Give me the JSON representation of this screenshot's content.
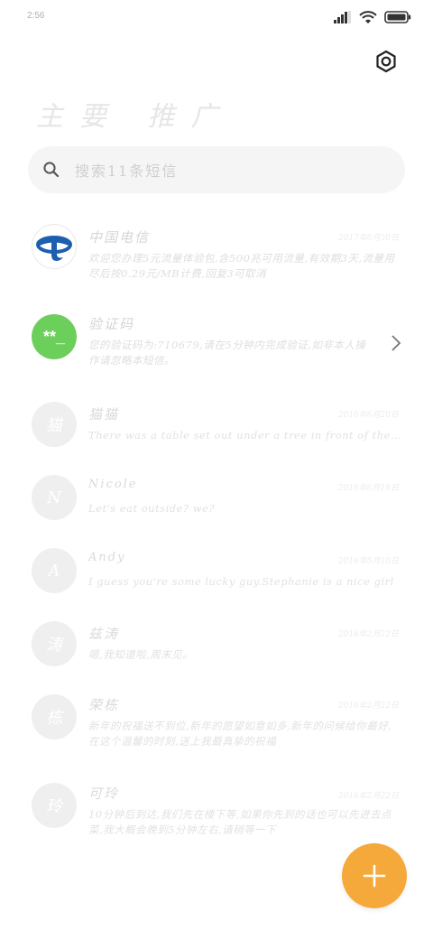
{
  "status_bar": {
    "time": "2:56"
  },
  "header": {
    "title": "主要  推广"
  },
  "search": {
    "placeholder": "搜索11条短信"
  },
  "messages": [
    {
      "sender": "中国电信",
      "date": "2017年6月30日",
      "preview": "欢迎您办理5元流量体验包,含500兆可用流量,有效期3天,流量用尽后按0.29元/MB计费,回复3可取消"
    },
    {
      "sender": "验证码",
      "avatar_text": "**_",
      "preview": "您的验证码为:710679,请在5分钟内完成验证,如非本人操作请忽略本短信。",
      "avatar_color": "#6ccf5b"
    },
    {
      "sender": "猫猫",
      "avatar_text": "猫",
      "date": "2016年6月20日",
      "preview": "There was a table set out under a tree in front of the hous"
    },
    {
      "sender": "Nicole",
      "avatar_text": "N",
      "date": "2016年6月18日",
      "preview": "Let's eat outside? we?"
    },
    {
      "sender": "Andy",
      "avatar_text": "A",
      "date": "2016年5月10日",
      "preview": "I guess you're some lucky guy.Stephanie is a nice girl"
    },
    {
      "sender": "兹涛",
      "avatar_text": "涛",
      "date": "2016年2月22日",
      "preview": "嗯,我知道啦,周末见。"
    },
    {
      "sender": "荣栋",
      "avatar_text": "栋",
      "date": "2016年2月22日",
      "preview": "新年的祝福送不到位,新年的愿望如意如多,新年的问候给你最好,在这个温馨的时刻,送上我最真挚的祝福"
    },
    {
      "sender": "可玲",
      "avatar_text": "玲",
      "date": "2016年2月22日",
      "preview": "10分钟后到达,我们先在楼下等,如果你先到的话也可以先进去点菜,我大概会晚到5分钟左右,请稍等一下"
    }
  ],
  "fab": {
    "icon": "plus-icon",
    "color": "#f5a93a"
  },
  "colors": {
    "accent": "#f5a93a",
    "verification_green": "#6ccf5b",
    "telecom_blue": "#1d5fae"
  }
}
